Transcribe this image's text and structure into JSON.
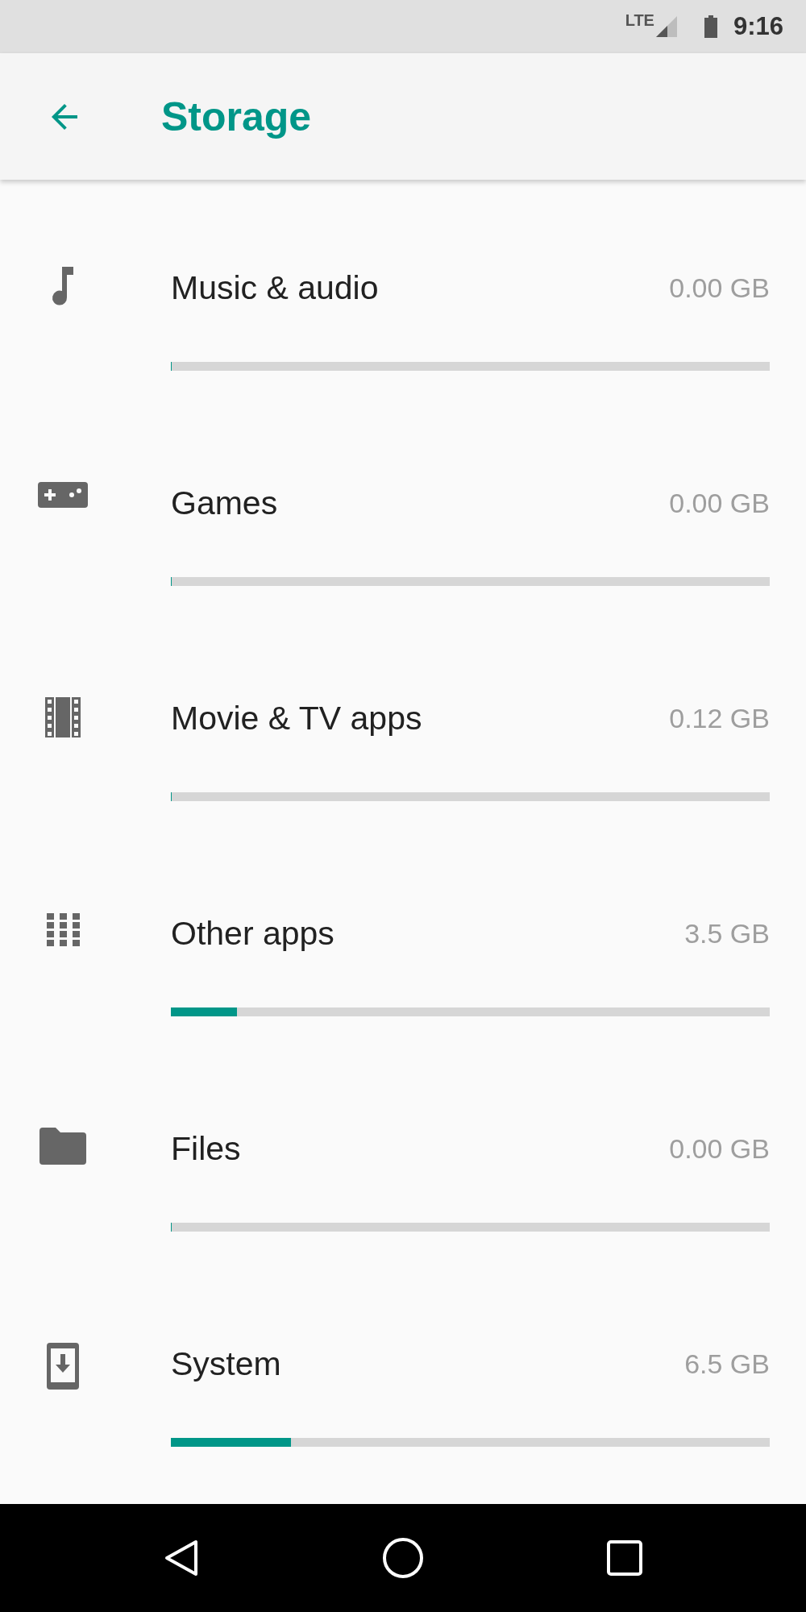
{
  "status_bar": {
    "network": "LTE",
    "time": "9:16"
  },
  "app_bar": {
    "title": "Storage"
  },
  "categories": [
    {
      "kind": "music",
      "label": "Music & audio",
      "size": "0.00 GB",
      "level": 0
    },
    {
      "kind": "games",
      "label": "Games",
      "size": "0.00 GB",
      "level": 0
    },
    {
      "kind": "movie",
      "label": "Movie & TV apps",
      "size": "0.12 GB",
      "level": 0
    },
    {
      "kind": "apps",
      "label": "Other apps",
      "size": "3.5 GB",
      "level": 0.11
    },
    {
      "kind": "folder",
      "label": "Files",
      "size": "0.00 GB",
      "level": 0
    },
    {
      "kind": "system",
      "label": "System",
      "size": "6.5 GB",
      "level": 0.2
    }
  ]
}
